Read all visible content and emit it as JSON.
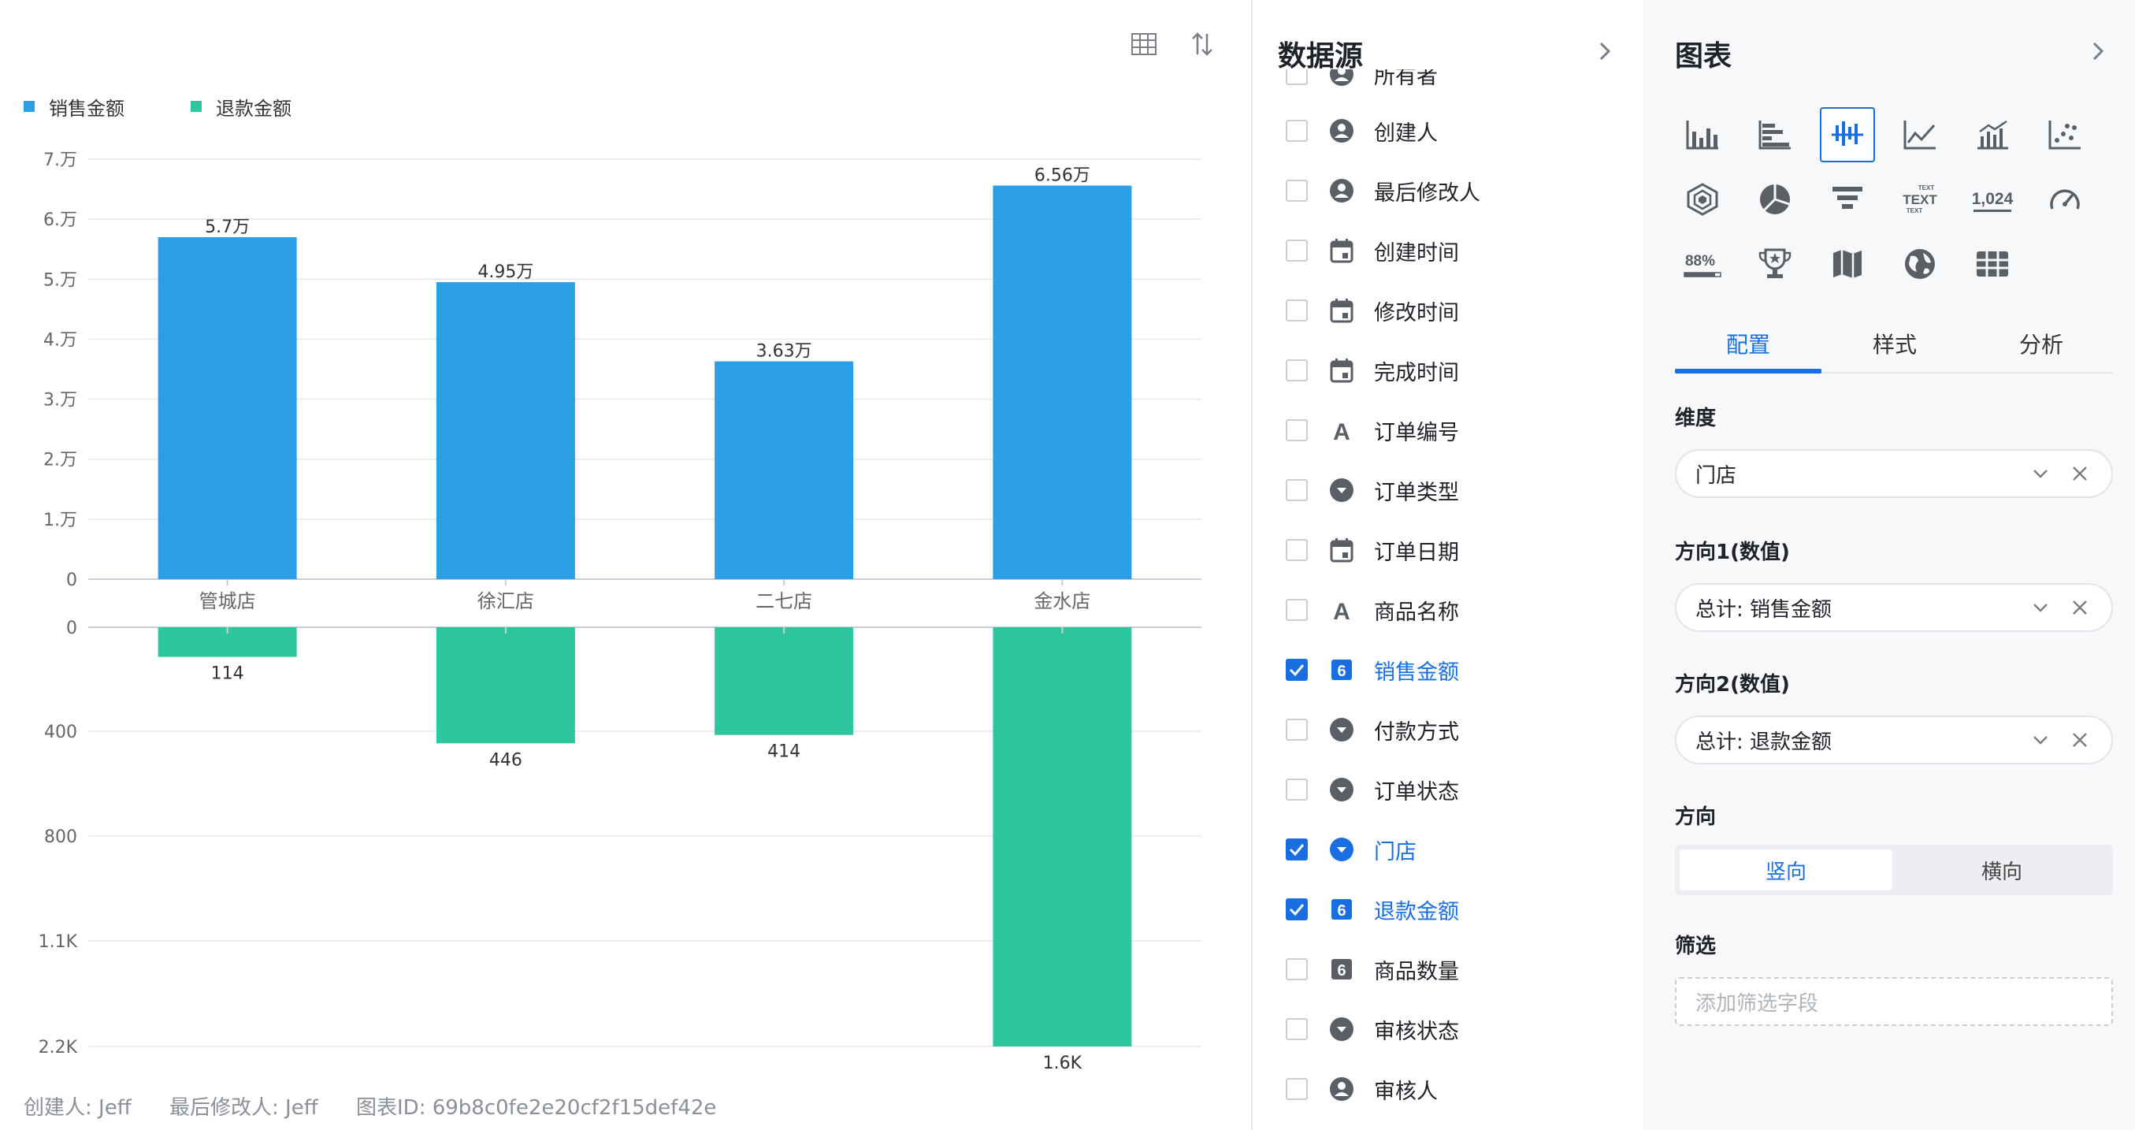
{
  "toolbar": {
    "table_icon": "table-icon",
    "swap_icon": "swap-axis-icon"
  },
  "legend": [
    {
      "label": "销售金额",
      "color": "#2a9fe5"
    },
    {
      "label": "退款金额",
      "color": "#2ec69e"
    }
  ],
  "chart_data": {
    "type": "bar",
    "categories": [
      "管城店",
      "徐汇店",
      "二七店",
      "金水店"
    ],
    "series": [
      {
        "name": "销售金额",
        "color": "#2a9fe5",
        "values": [
          57000,
          49500,
          36300,
          65600
        ],
        "labels": [
          "5.7万",
          "4.95万",
          "3.63万",
          "6.56万"
        ]
      },
      {
        "name": "退款金额",
        "color": "#2ec69e",
        "values": [
          114,
          446,
          414,
          1600
        ],
        "labels": [
          "114",
          "446",
          "414",
          "1.6K"
        ]
      }
    ],
    "top_axis": {
      "ylim": [
        0,
        70000
      ],
      "ticks": [
        "0",
        "1.万",
        "2.万",
        "3.万",
        "4.万",
        "5.万",
        "6.万",
        "7.万"
      ]
    },
    "bottom_axis": {
      "ticks": [
        "0",
        "400",
        "800",
        "1.1K",
        "2.2K"
      ]
    },
    "grid": true,
    "legend_position": "top-left"
  },
  "footer": {
    "creator": "创建人: Jeff",
    "modifier": "最后修改人: Jeff",
    "chart_id": "图表ID: 69b8c0fe2e20cf2f15def42e"
  },
  "datasource": {
    "title": "数据源",
    "fields": [
      {
        "label": "所有者",
        "icon": "person-icon",
        "checked": false
      },
      {
        "label": "创建人",
        "icon": "person-icon",
        "checked": false
      },
      {
        "label": "最后修改人",
        "icon": "person-icon",
        "checked": false
      },
      {
        "label": "创建时间",
        "icon": "calendar-icon",
        "checked": false
      },
      {
        "label": "修改时间",
        "icon": "calendar-icon",
        "checked": false
      },
      {
        "label": "完成时间",
        "icon": "calendar-icon",
        "checked": false
      },
      {
        "label": "订单编号",
        "icon": "text-icon",
        "checked": false
      },
      {
        "label": "订单类型",
        "icon": "dropdown-icon",
        "checked": false
      },
      {
        "label": "订单日期",
        "icon": "calendar-icon",
        "checked": false
      },
      {
        "label": "商品名称",
        "icon": "text-icon",
        "checked": false
      },
      {
        "label": "销售金额",
        "icon": "number-icon",
        "checked": true
      },
      {
        "label": "付款方式",
        "icon": "dropdown-icon",
        "checked": false
      },
      {
        "label": "订单状态",
        "icon": "dropdown-icon",
        "checked": false
      },
      {
        "label": "门店",
        "icon": "dropdown-icon",
        "checked": true
      },
      {
        "label": "退款金额",
        "icon": "number-icon",
        "checked": true
      },
      {
        "label": "商品数量",
        "icon": "number-icon",
        "checked": false
      },
      {
        "label": "审核状态",
        "icon": "dropdown-icon",
        "checked": false
      },
      {
        "label": "审核人",
        "icon": "person-icon",
        "checked": false
      }
    ]
  },
  "chart_config": {
    "title": "图表",
    "chart_types": [
      "bar-chart-icon",
      "horizontal-bar-chart-icon",
      "bidirectional-bar-chart-icon",
      "line-chart-icon",
      "combo-chart-icon",
      "scatter-chart-icon",
      "radar-chart-icon",
      "pie-chart-icon",
      "funnel-chart-icon",
      "word-cloud-icon",
      "number-card-icon",
      "gauge-chart-icon",
      "progress-icon",
      "ranking-icon",
      "map-icon",
      "globe-icon",
      "pivot-table-icon"
    ],
    "selected_chart_type": "bidirectional-bar-chart-icon",
    "word_cloud_text": "TEXT",
    "number_card_text": "1,024",
    "progress_text": "88%",
    "tabs": [
      "配置",
      "样式",
      "分析"
    ],
    "active_tab": "配置",
    "dimension_label": "维度",
    "dimension_value": "门店",
    "dir1_label": "方向1(数值)",
    "dir1_value": "总计: 销售金额",
    "dir2_label": "方向2(数值)",
    "dir2_value": "总计: 退款金额",
    "direction_label": "方向",
    "direction_options": [
      "竖向",
      "横向"
    ],
    "direction_selected": "竖向",
    "filter_label": "筛选",
    "filter_placeholder": "添加筛选字段"
  }
}
